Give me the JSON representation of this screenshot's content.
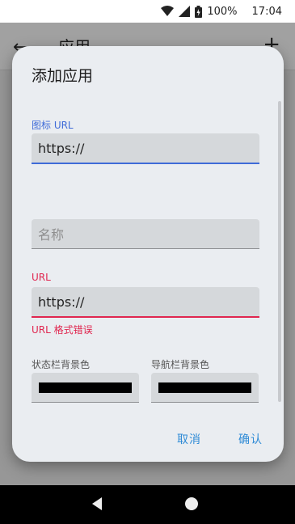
{
  "status_bar": {
    "battery_text": "100%",
    "clock": "17:04"
  },
  "app_bar": {
    "title": "应用",
    "back_glyph": "←",
    "add_glyph": "+"
  },
  "dialog": {
    "title": "添加应用",
    "icon_url": {
      "label": "图标 URL",
      "value": "https://"
    },
    "name": {
      "placeholder": "名称",
      "value": ""
    },
    "url": {
      "label": "URL",
      "value": "https://",
      "error": "URL 格式错误"
    },
    "status_bar_color": {
      "label": "状态栏背景色"
    },
    "nav_bar_color": {
      "label": "导航栏背景色"
    },
    "cancel_label": "取消",
    "confirm_label": "确认"
  },
  "colors": {
    "accent": "#3f6bd8",
    "error": "#e0264f",
    "button_text": "#2f8bd6",
    "swatch_status": "#000000",
    "swatch_nav": "#000000"
  }
}
